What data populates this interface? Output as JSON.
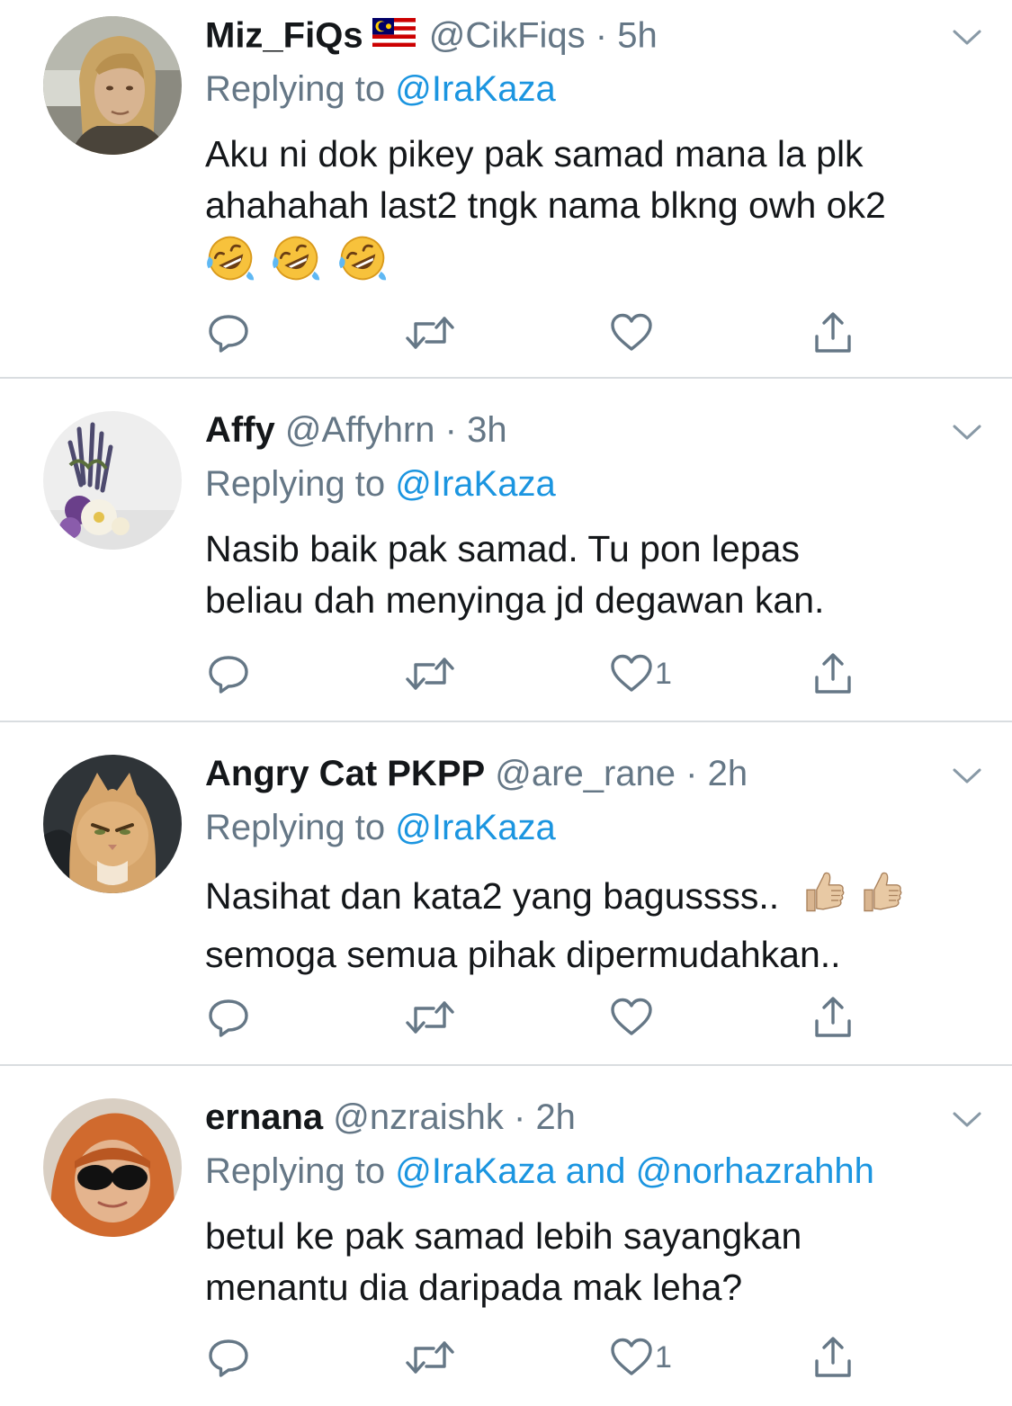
{
  "tweets": [
    {
      "display_name": "Miz_FiQs",
      "flag_icon": "malaysia-flag-icon",
      "handle": "@CikFiqs",
      "dot": "·",
      "time": "5h",
      "replying_prefix": "Replying to ",
      "replying_mentions": "@IraKaza",
      "text_lines": [
        "Aku ni dok pikey pak samad mana la plk",
        "ahahahah last2 tngk nama blkng owh ok2"
      ],
      "emojis": [
        "rolling-on-floor-laughing-emoji",
        "rolling-on-floor-laughing-emoji",
        "rolling-on-floor-laughing-emoji"
      ],
      "like_count": ""
    },
    {
      "display_name": "Affy",
      "handle": "@Affyhrn",
      "dot": "·",
      "time": "3h",
      "replying_prefix": "Replying to ",
      "replying_mentions": "@IraKaza",
      "text_lines": [
        "Nasib baik pak samad. Tu pon lepas",
        "beliau dah menyinga jd degawan kan."
      ],
      "like_count": "1"
    },
    {
      "display_name": "Angry Cat PKPP",
      "handle": "@are_rane",
      "dot": "·",
      "time": "2h",
      "replying_prefix": "Replying to ",
      "replying_mentions": "@IraKaza",
      "text_lines": [
        "Nasihat dan kata2 yang bagussss..",
        "semoga semua pihak dipermudahkan.."
      ],
      "emojis": [
        "thumbs-up-emoji",
        "thumbs-up-emoji"
      ],
      "like_count": ""
    },
    {
      "display_name": "ernana",
      "handle": "@nzraishk",
      "dot": "·",
      "time": "2h",
      "replying_prefix": "Replying to ",
      "replying_mentions": "@IraKaza and @norhazrahhh",
      "text_lines": [
        "betul ke pak samad lebih sayangkan",
        "menantu dia daripada mak leha?"
      ],
      "like_count": "1"
    }
  ],
  "colors": {
    "text": "#14171a",
    "secondary": "#657786",
    "mention": "#1b95e0",
    "divider": "#d9dde0"
  }
}
